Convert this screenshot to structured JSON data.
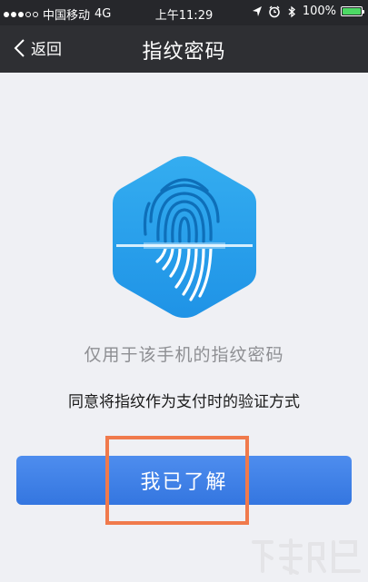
{
  "status_bar": {
    "carrier": "中国移动",
    "network": "4G",
    "time": "上午11:29",
    "battery": "100%",
    "battery_level": 1.0,
    "signal_bars_filled": 3,
    "signal_bars_total": 5,
    "icons": [
      "location-arrow-icon",
      "alarm-icon",
      "bluetooth-icon",
      "battery-icon"
    ]
  },
  "nav": {
    "back_label": "返回",
    "title": "指纹密码"
  },
  "main": {
    "icon": "fingerprint-hexagon-icon",
    "hint": "仅用于该手机的指纹密码",
    "agreement": "同意将指纹作为支付时的验证方式",
    "button_label": "我已了解"
  },
  "colors": {
    "accent_blue": "#3b7fe8",
    "hex_blue": "#2aa2ec",
    "highlight": "#f07a4c",
    "navbar": "#2e2f33"
  }
}
